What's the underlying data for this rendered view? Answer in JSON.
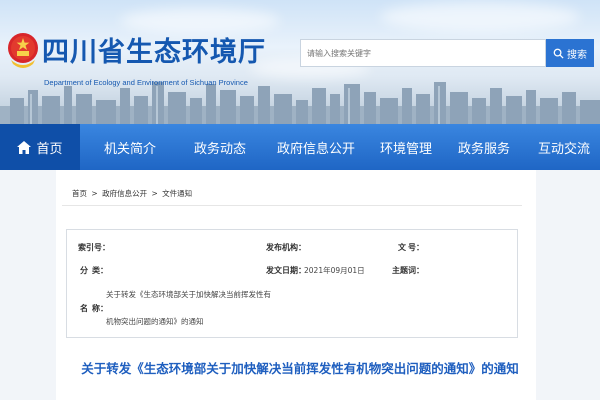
{
  "header": {
    "site_title": "四川省生态环境厅",
    "site_subtitle": "Department of Ecology and Environment of Sichuan Province",
    "search": {
      "placeholder": "请输入搜索关键字",
      "button_label": "搜索"
    }
  },
  "nav": {
    "items": [
      {
        "label": "首页"
      },
      {
        "label": "机关简介"
      },
      {
        "label": "政务动态"
      },
      {
        "label": "政府信息公开"
      },
      {
        "label": "环境管理"
      },
      {
        "label": "政务服务"
      },
      {
        "label": "互动交流"
      }
    ]
  },
  "breadcrumb": [
    "首页",
    ">",
    "政府信息公开",
    ">",
    "文件通知"
  ],
  "info": {
    "index_label": "索引号：",
    "index_value": "",
    "publisher_label": "发布机构：",
    "publisher_value": "",
    "docno_label": "文",
    "docno_label2": "号：",
    "docno_value": "",
    "category_label": "分",
    "category_label2": "类：",
    "category_value": "",
    "date_label": "发文日期：",
    "date_value": "2021年09月01日",
    "topic_label": "主题词：",
    "topic_value": "",
    "name_label": "名",
    "name_label2": "称：",
    "name_line1": "关于转发《生态环境部关于加快解决当前挥发性有",
    "name_line2": "机物突出问题的通知》的通知"
  },
  "document": {
    "title": "关于转发《生态环境部关于加快解决当前挥发性有机物突出问题的通知》的通知"
  },
  "colors": {
    "brand_blue": "#1f66c5",
    "title_blue": "#1f5fbf",
    "nav_active": "#0f4fa8"
  }
}
